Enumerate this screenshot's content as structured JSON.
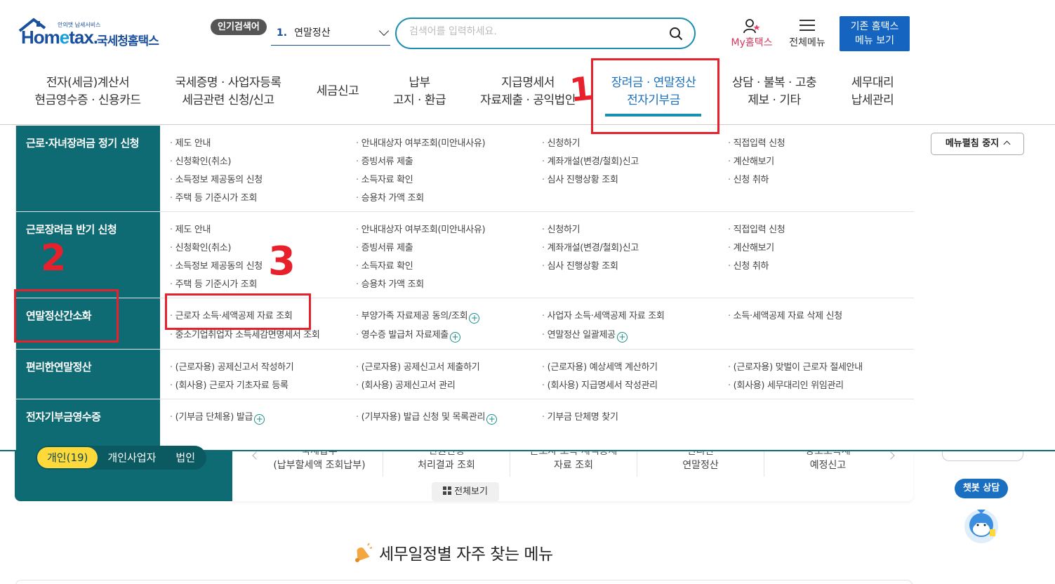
{
  "header": {
    "logo_sub": "안의맷 납세서비스",
    "logo_brand_1": "Hom",
    "logo_brand_e": "e",
    "logo_brand_2": "tax.",
    "logo_kr": "국세청홈택스",
    "popular_badge": "인기검색어",
    "popular_rank": "1.",
    "popular_term": "연말정산",
    "search_placeholder": "검색어를 입력하세요.",
    "my_hometax": "My홈택스",
    "all_menu": "전체메뉴",
    "old_menu": "기존 홈택스\n메뉴 보기"
  },
  "gnb": [
    "전자(세금)계산서\n현금영수증 · 신용카드",
    "국세증명 · 사업자등록\n세금관련 신청/신고",
    "세금신고",
    "납부\n고지 · 환급",
    "지급명세서\n자료제출 · 공익법인",
    "장려금 · 연말정산\n전자기부금",
    "상담 · 불복 · 고충\n제보 · 기타",
    "세무대리\n납세관리"
  ],
  "annotations": {
    "one": "1",
    "two": "2",
    "three": "3"
  },
  "mega": {
    "categories": [
      "근로·자녀장려금 정기 신청",
      "근로장려금 반기 신청",
      "연말정산간소화",
      "편리한연말정산",
      "전자기부금영수증"
    ],
    "sec1": [
      "제도 안내",
      "안내대상자 여부조회(미안내사유)",
      "신청하기",
      "직접입력 신청",
      "신청확인(취소)",
      "증빙서류 제출",
      "계좌개설(변경/철회)신고",
      "계산해보기",
      "소득정보 제공동의 신청",
      "소득자료 확인",
      "심사 진행상황 조회",
      "신청 취하",
      "주택 등 기준시가 조회",
      "승용차 가액 조회"
    ],
    "sec2": [
      "제도 안내",
      "안내대상자 여부조회(미안내사유)",
      "신청하기",
      "직접입력 신청",
      "신청확인(취소)",
      "증빙서류 제출",
      "계좌개설(변경/철회)신고",
      "계산해보기",
      "소득정보 제공동의 신청",
      "소득자료 확인",
      "심사 진행상황 조회",
      "신청 취하",
      "주택 등 기준시가 조회",
      "승용차 가액 조회"
    ],
    "sec3": [
      "근로자 소득·세액공제 자료 조회",
      "부양가족 자료제공 동의/조회",
      "사업자 소득·세액공제 자료 조회",
      "소득·세액공제 자료 삭제 신청",
      "중소기업취업자 소득세감면명세서 조회",
      "영수증 발급처 자료제출",
      "연말정산 일괄제공"
    ],
    "sec4": [
      "(근로자용) 공제신고서 작성하기",
      "(근로자용) 공제신고서 제출하기",
      "(근로자용) 예상세액 계산하기",
      "(근로자용) 맞벌이 근로자 절세안내",
      "(회사용) 근로자 기초자료 등록",
      "(회사용) 공제신고서 관리",
      "(회사용) 지급명세서 작성관리",
      "(회사용) 세무대리인 위임관리"
    ],
    "sec5": [
      "(기부금 단체용) 발급",
      "(기부자용) 발급 신청 및 목록관리",
      "기부금 단체명 찾기"
    ],
    "plus": "+",
    "stop_label": "메뉴펼침 중지"
  },
  "below": {
    "tabs": [
      "개인(19)",
      "개인사업자",
      "법인"
    ],
    "quick": [
      {
        "top": "국세납부",
        "label": "(납부할세액 조회납부)"
      },
      {
        "top": "민원신청",
        "label": "처리결과 조회"
      },
      {
        "top": "근로자 소득·세액공제",
        "label": "자료 조회"
      },
      {
        "top": "편리한",
        "label": "연말정산"
      },
      {
        "top": "양도소득세",
        "label": "예정신고"
      }
    ],
    "view_all": "전체보기",
    "chatbot": "챗봇 상담",
    "section_title": "세무일정별 자주 찾는 메뉴"
  },
  "colors": {
    "teal": "#0f6b73",
    "brand_blue": "#1a4f9e",
    "annotation_red": "#e8202c",
    "accent_yellow": "#ffd83a"
  }
}
